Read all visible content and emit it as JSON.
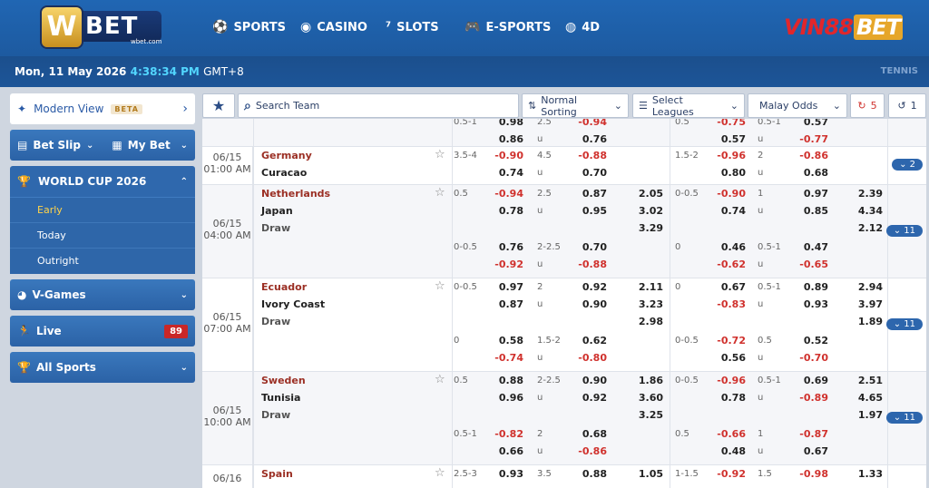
{
  "header": {
    "logo_main": "W",
    "logo_bet": "BET",
    "logo_sub": "wbet.com",
    "nav": [
      {
        "label": "SPORTS",
        "icon": "soccer-ball-icon"
      },
      {
        "label": "CASINO",
        "icon": "chip-icon"
      },
      {
        "label": "SLOTS",
        "icon": "seven-icon"
      },
      {
        "label": "E-SPORTS",
        "icon": "gamepad-icon"
      },
      {
        "label": "4D",
        "icon": "globe-icon"
      }
    ],
    "partner_a": "VIN88",
    "partner_b": "BET"
  },
  "datebar": {
    "date": "Mon, 11 May 2026",
    "time": "4:38:34 PM",
    "tz": "GMT+8",
    "right": "TENNIS"
  },
  "sidebar": {
    "modern_view": "Modern View",
    "beta": "BETA",
    "bet_slip": "Bet Slip",
    "my_bet": "My Bet",
    "world_cup": "WORLD CUP 2026",
    "wc_items": [
      "Early",
      "Today",
      "Outright"
    ],
    "vgames": "V-Games",
    "live": "Live",
    "live_count": "89",
    "all_sports": "All Sports"
  },
  "filters": {
    "search_placeholder": "Search Team",
    "sorting": "Normal Sorting",
    "leagues": "Select Leagues",
    "odds": "Malay Odds",
    "refresh": "5",
    "back": "1"
  },
  "matches": [
    {
      "partial": true,
      "lines": [
        [
          "0.5-1",
          "0.98",
          "0.86",
          "2.5",
          "-0.94",
          "u",
          "0.76",
          "",
          "",
          "",
          "0.5",
          "-0.75",
          "0.57",
          "0.5-1",
          "0.57",
          "u",
          "-0.77",
          "",
          ""
        ]
      ]
    },
    {
      "date": "06/15",
      "time": "01:00 AM",
      "home": "Germany",
      "away": "Curacao",
      "draw": "",
      "more": "2",
      "lines": [
        [
          "3.5-4",
          "-0.90",
          "0.74",
          "4.5",
          "-0.88",
          "u",
          "0.70",
          "",
          "",
          "",
          "1.5-2",
          "-0.96",
          "0.80",
          "2",
          "-0.86",
          "u",
          "0.68",
          "",
          ""
        ]
      ]
    },
    {
      "date": "06/15",
      "time": "04:00 AM",
      "home": "Netherlands",
      "away": "Japan",
      "draw": "Draw",
      "more": "11",
      "lines": [
        [
          "0.5",
          "-0.94",
          "0.78",
          "2.5",
          "0.87",
          "u",
          "0.95",
          "2.05",
          "3.02",
          "3.29",
          "0-0.5",
          "-0.90",
          "0.74",
          "1",
          "0.97",
          "u",
          "0.85",
          "2.39",
          "4.34",
          "2.12"
        ],
        [
          "0-0.5",
          "0.76",
          "-0.92",
          "2-2.5",
          "0.70",
          "u",
          "-0.88",
          "",
          "",
          "",
          "0",
          "0.46",
          "-0.62",
          "0.5-1",
          "0.47",
          "u",
          "-0.65",
          "",
          ""
        ]
      ]
    },
    {
      "date": "06/15",
      "time": "07:00 AM",
      "home": "Ecuador",
      "away": "Ivory Coast",
      "draw": "Draw",
      "more": "11",
      "lines": [
        [
          "0-0.5",
          "0.97",
          "0.87",
          "2",
          "0.92",
          "u",
          "0.90",
          "2.11",
          "3.23",
          "2.98",
          "0",
          "0.67",
          "-0.83",
          "0.5-1",
          "0.89",
          "u",
          "0.93",
          "2.94",
          "3.97",
          "1.89"
        ],
        [
          "0",
          "0.58",
          "-0.74",
          "1.5-2",
          "0.62",
          "u",
          "-0.80",
          "",
          "",
          "",
          "0-0.5",
          "-0.72",
          "0.56",
          "0.5",
          "0.52",
          "u",
          "-0.70",
          "",
          ""
        ]
      ]
    },
    {
      "date": "06/15",
      "time": "10:00 AM",
      "home": "Sweden",
      "away": "Tunisia",
      "draw": "Draw",
      "more": "11",
      "lines": [
        [
          "0.5",
          "0.88",
          "0.96",
          "2-2.5",
          "0.90",
          "u",
          "0.92",
          "1.86",
          "3.60",
          "3.25",
          "0-0.5",
          "-0.96",
          "0.78",
          "0.5-1",
          "0.69",
          "u",
          "-0.89",
          "2.51",
          "4.65",
          "1.97"
        ],
        [
          "0.5-1",
          "-0.82",
          "0.66",
          "2",
          "0.68",
          "u",
          "-0.86",
          "",
          "",
          "",
          "0.5",
          "-0.66",
          "0.48",
          "1",
          "-0.87",
          "u",
          "0.67",
          "",
          ""
        ]
      ]
    },
    {
      "date": "06/16",
      "time": "",
      "home": "Spain",
      "away": "",
      "draw": "",
      "more": "",
      "lines": [
        [
          "2.5-3",
          "0.93",
          "",
          "3.5",
          "0.88",
          "",
          "",
          "1.05",
          "",
          "",
          "1-1.5",
          "-0.92",
          "",
          "1.5",
          "-0.98",
          "",
          "",
          "1.33",
          "",
          ""
        ]
      ]
    }
  ]
}
